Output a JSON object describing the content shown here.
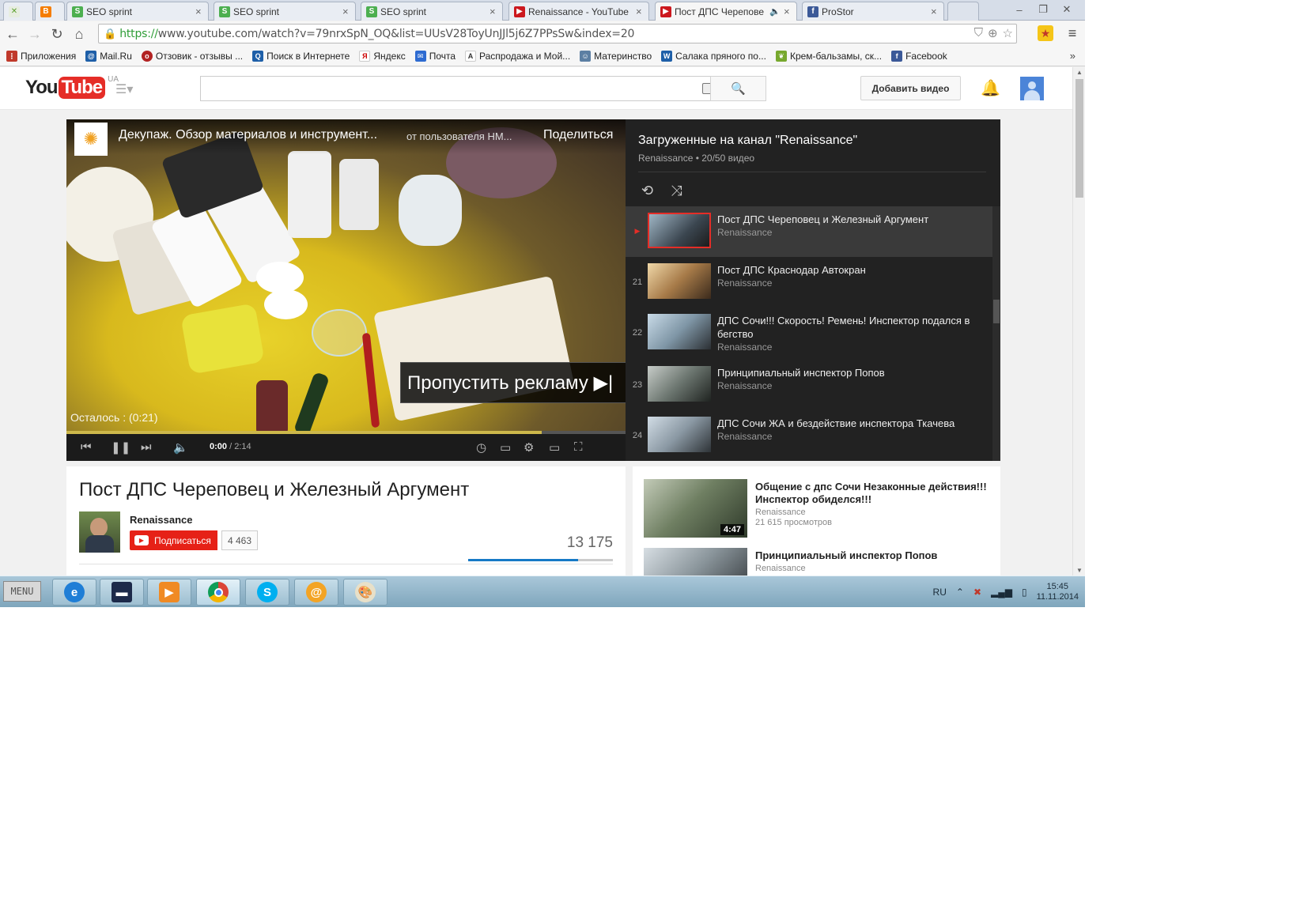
{
  "browser": {
    "tabs": [
      {
        "label": "",
        "icon": "app-icon",
        "active": false
      },
      {
        "label": "",
        "icon": "blogger-icon",
        "active": false
      },
      {
        "label": "SEO sprint",
        "icon": "seosprint-icon",
        "active": false
      },
      {
        "label": "SEO sprint",
        "icon": "seosprint-icon",
        "active": false
      },
      {
        "label": "SEO sprint",
        "icon": "seosprint-icon",
        "active": false
      },
      {
        "label": "Renaissance - YouTube",
        "icon": "youtube-icon",
        "active": false
      },
      {
        "label": "Пост ДПС Черепове",
        "icon": "youtube-icon",
        "active": true
      },
      {
        "label": "ProStor",
        "icon": "facebook-icon",
        "active": false
      }
    ],
    "url_scheme": "https://",
    "url_rest": "www.youtube.com/watch?v=79nrxSpN_OQ&list=UUsV28ToyUnJJl5j6Z7PPsSw&index=20",
    "bookmarks": [
      {
        "label": "Приложения",
        "color": "#c0392b"
      },
      {
        "label": "Mail.Ru",
        "color": "#1e5fa8"
      },
      {
        "label": "Отзовик - отзывы ...",
        "color": "#b22222"
      },
      {
        "label": "Поиск в Интернете",
        "color": "#1e5fa8"
      },
      {
        "label": "Яндекс",
        "color": "#cc0000"
      },
      {
        "label": "Почта",
        "color": "#2e6bd1"
      },
      {
        "label": "Распродажа и Мой...",
        "color": "#333333"
      },
      {
        "label": "Материнство",
        "color": "#5c7fa3"
      },
      {
        "label": "Салака пряного по...",
        "color": "#1e5fa8"
      },
      {
        "label": "Крем-бальзамы, ск...",
        "color": "#77a82e"
      },
      {
        "label": "Facebook",
        "color": "#3b5998"
      }
    ],
    "bookmarks_more": "»"
  },
  "youtube": {
    "logo_you": "You",
    "logo_tube": "Tube",
    "region": "UA",
    "upload_label": "Добавить видео",
    "player": {
      "title": "Декупаж. Обзор материалов и инструмент...",
      "by": "от пользователя НМ...",
      "share": "Поделиться",
      "skip_ad": "Пропустить рекламу ▶|",
      "remaining": "Осталось : (0:21)",
      "time_current": "0:00",
      "time_total": " / 2:14",
      "buffered_fraction": 0.85
    },
    "playlist": {
      "title": "Загруженные на канал \"Renaissance\"",
      "meta": "Renaissance • 20/50 видео",
      "items": [
        {
          "index": "▶",
          "title": "Пост ДПС Череповец и Железный Аргумент",
          "author": "Renaissance",
          "active": true
        },
        {
          "index": "21",
          "title": "Пост ДПС Краснодар Автокран",
          "author": "Renaissance",
          "active": false
        },
        {
          "index": "22",
          "title": "ДПС Сочи!!! Скорость! Ремень! Инспектор подался в бегство",
          "author": "Renaissance",
          "active": false
        },
        {
          "index": "23",
          "title": "Принципиальный инспектор Попов",
          "author": "Renaissance",
          "active": false
        },
        {
          "index": "24",
          "title": "ДПС Сочи ЖА и бездействие инспектора Ткачева",
          "author": "Renaissance",
          "active": false
        }
      ]
    },
    "video": {
      "title": "Пост ДПС Череповец и Железный Аргумент",
      "owner": "Renaissance",
      "subscribe": "Подписаться",
      "subscribers": "4 463",
      "views": "13 175",
      "like_fraction": 0.76
    },
    "related": [
      {
        "title": "Общение с дпс Сочи Незаконные действия!!! Инспектор обиделся!!!",
        "author": "Renaissance",
        "views": "21 615 просмотров",
        "duration": "4:47"
      },
      {
        "title": "Принципиальный инспектор Попов",
        "author": "Renaissance",
        "views": "",
        "duration": ""
      }
    ]
  },
  "taskbar": {
    "start": "MENU",
    "apps": [
      "ie",
      "monitor",
      "media",
      "chrome",
      "skype",
      "mail",
      "paint"
    ],
    "lang": "RU",
    "time": "15:45",
    "date": "11.11.2014"
  }
}
